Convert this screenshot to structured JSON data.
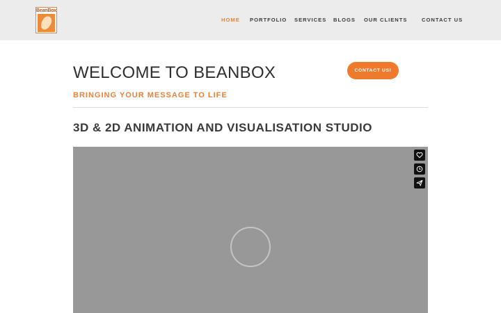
{
  "header": {
    "logo_text": "BeanBox",
    "nav": [
      {
        "label": "HOME",
        "active": true
      },
      {
        "label": "PORTFOLIO",
        "active": false
      },
      {
        "label": "SERVICES",
        "active": false
      },
      {
        "label": "BLOGS",
        "active": false
      },
      {
        "label": "OUR CLIENTS",
        "active": false
      },
      {
        "label": "CONTACT US",
        "active": false
      }
    ]
  },
  "hero": {
    "title": "WELCOME TO BEANBOX",
    "tagline": "BRINGING YOUR MESSAGE TO LIFE",
    "cta_label": "CONTACT US!"
  },
  "section": {
    "heading": "3D & 2D ANIMATION AND VISUALISATION STUDIO"
  },
  "video": {
    "state": "loading",
    "actions": [
      "heart-icon",
      "clock-icon",
      "send-icon"
    ]
  },
  "colors": {
    "accent": "#e8823a",
    "button": "#f07a2c",
    "header_bg": "#ececec",
    "video_bg": "#989898"
  }
}
